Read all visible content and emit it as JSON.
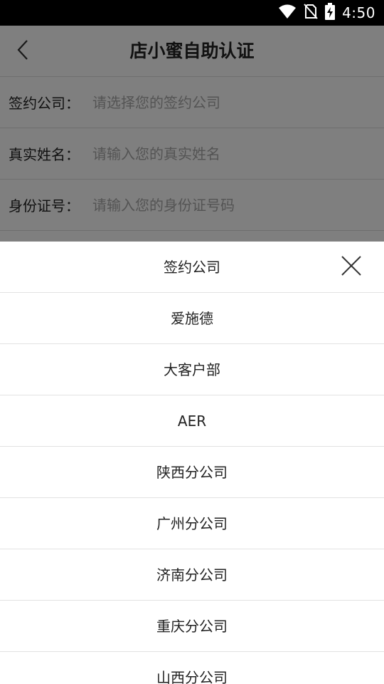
{
  "status_bar": {
    "time": "4:50",
    "icons": [
      "wifi-icon",
      "no-sim-icon",
      "battery-charging-icon"
    ]
  },
  "header": {
    "title": "店小蜜自助认证",
    "back_icon": "chevron-left-icon"
  },
  "form": {
    "company": {
      "label": "签约公司：",
      "placeholder": "请选择您的签约公司"
    },
    "name": {
      "label": "真实姓名：",
      "placeholder": "请输入您的真实姓名"
    },
    "id_number": {
      "label": "身份证号：",
      "placeholder": "请输入您的身份证号码"
    }
  },
  "picker": {
    "title": "签约公司",
    "close_icon": "close-icon",
    "options": [
      "爱施德",
      "大客户部",
      "AER",
      "陕西分公司",
      "广州分公司",
      "济南分公司",
      "重庆分公司",
      "山西分公司"
    ]
  },
  "colors": {
    "status_bar": "#000000",
    "overlay": "rgba(0,0,0,0.5)",
    "divider": "#dcdcdc",
    "placeholder": "#a8a8a8"
  }
}
